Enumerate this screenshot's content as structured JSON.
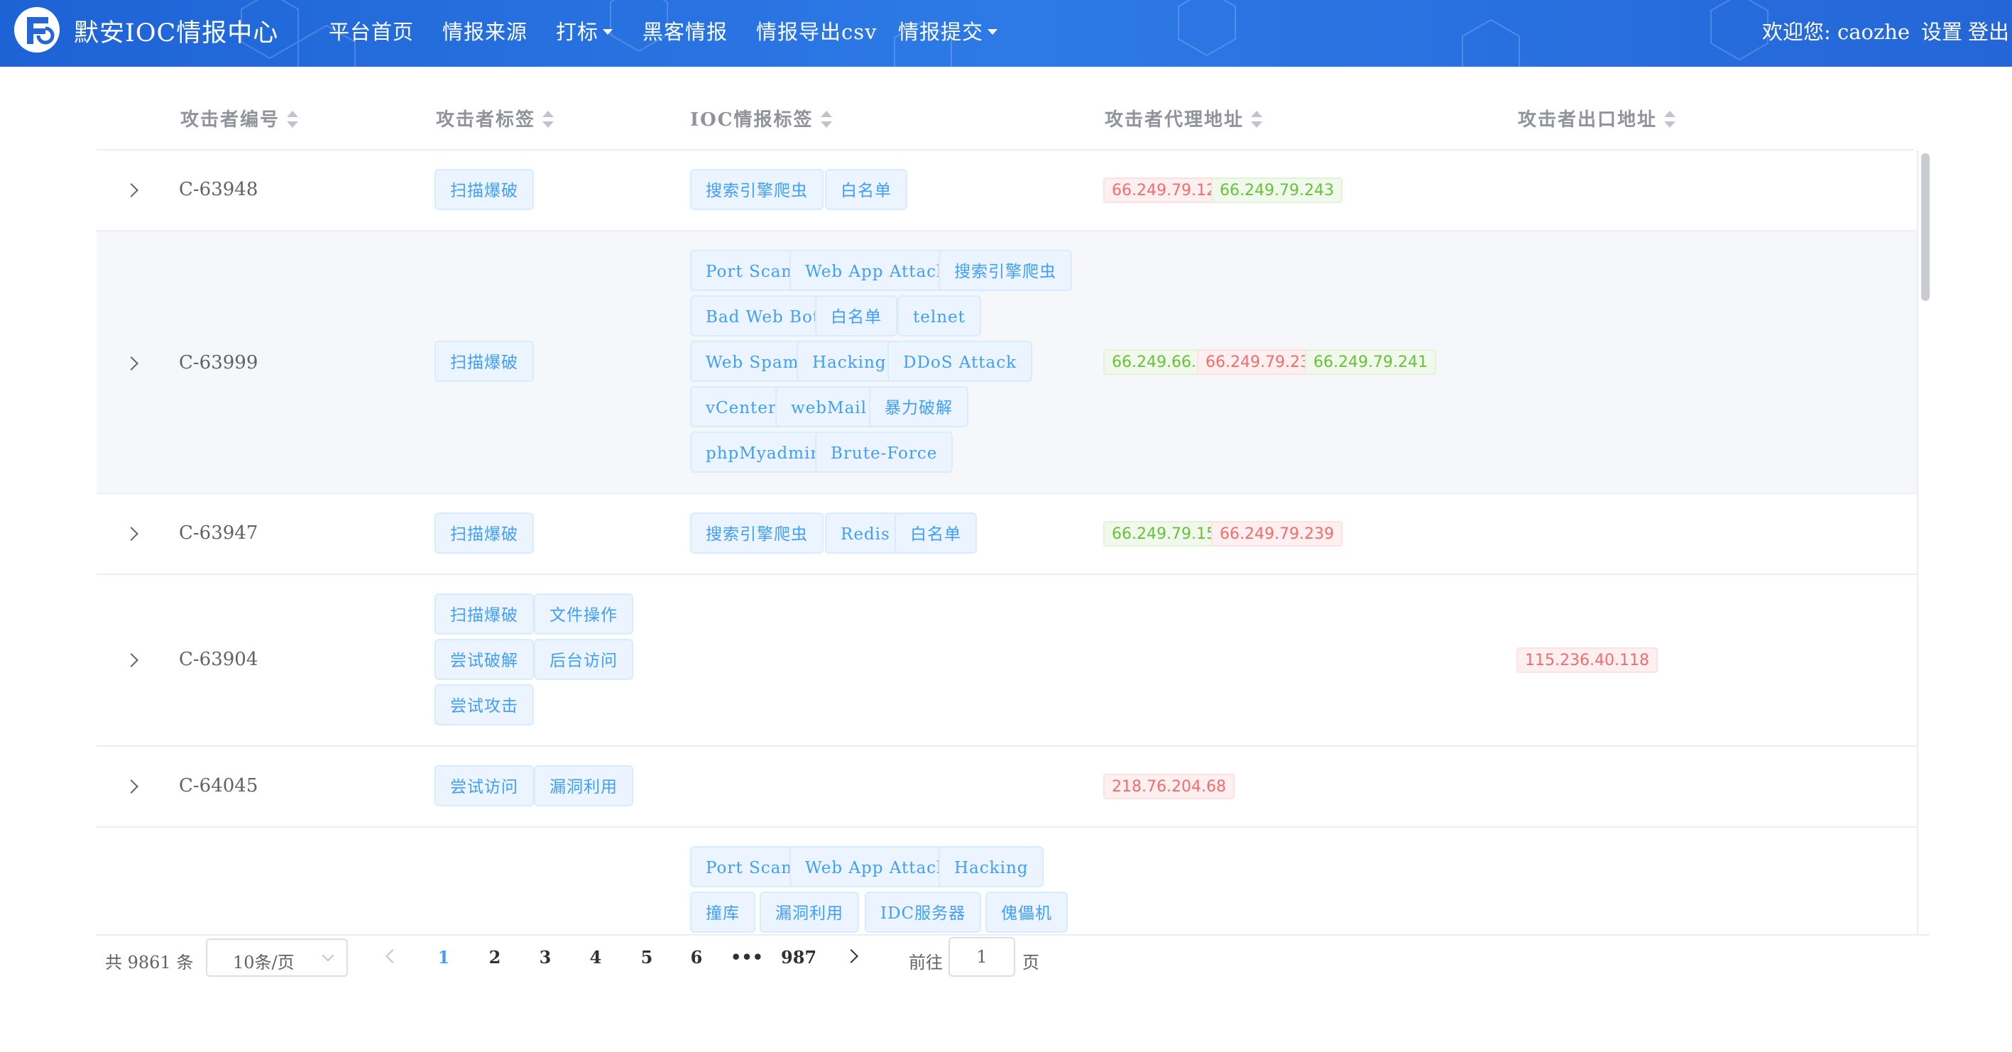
{
  "app": {
    "brand": "默安IOC情报中心"
  },
  "nav": {
    "items": [
      "平台首页",
      "情报来源",
      "打标",
      "黑客情报",
      "情报导出csv",
      "情报提交"
    ],
    "welcome": "欢迎您: caozhe",
    "settings": "设置",
    "logout": "登出"
  },
  "table": {
    "columns": [
      "攻击者编号",
      "攻击者标签",
      "IOC情报标签",
      "攻击者代理地址",
      "攻击者出口地址"
    ],
    "rows": [
      {
        "id": "C-63948",
        "attacker_tags": [
          "扫描爆破"
        ],
        "ioc_tags": [
          "搜索引擎爬虫",
          "白名单"
        ],
        "proxy_ips": [
          {
            "ip": "66.249.79.129",
            "color": "red"
          },
          {
            "ip": "66.249.79.243",
            "color": "green"
          }
        ],
        "exit_ips": []
      },
      {
        "id": "C-63999",
        "attacker_tags": [
          "扫描爆破"
        ],
        "ioc_tags": [
          "Port Scan",
          "Web App Attack",
          "搜索引擎爬虫",
          "Bad Web Bot",
          "白名单",
          "telnet",
          "Web Spam",
          "Hacking",
          "DDoS Attack",
          "vCenter",
          "webMail",
          "暴力破解",
          "phpMyadmin",
          "Brute-Force"
        ],
        "proxy_ips": [
          {
            "ip": "66.249.66.1",
            "color": "green"
          },
          {
            "ip": "66.249.79.239",
            "color": "red"
          },
          {
            "ip": "66.249.79.241",
            "color": "green"
          }
        ],
        "exit_ips": []
      },
      {
        "id": "C-63947",
        "attacker_tags": [
          "扫描爆破"
        ],
        "ioc_tags": [
          "搜索引擎爬虫",
          "Redis",
          "白名单"
        ],
        "proxy_ips": [
          {
            "ip": "66.249.79.159",
            "color": "green"
          },
          {
            "ip": "66.249.79.239",
            "color": "red"
          }
        ],
        "exit_ips": []
      },
      {
        "id": "C-63904",
        "attacker_tags": [
          "扫描爆破",
          "文件操作",
          "尝试破解",
          "后台访问",
          "尝试攻击"
        ],
        "ioc_tags": [],
        "proxy_ips": [],
        "exit_ips": [
          {
            "ip": "115.236.40.118",
            "color": "red"
          }
        ]
      },
      {
        "id": "C-64045",
        "attacker_tags": [
          "尝试访问",
          "漏洞利用"
        ],
        "ioc_tags": [],
        "proxy_ips": [
          {
            "ip": "218.76.204.68",
            "color": "red"
          }
        ],
        "exit_ips": []
      },
      {
        "id": "",
        "attacker_tags": [],
        "ioc_tags": [
          "Port Scan",
          "Web App Attack",
          "Hacking",
          "撞库",
          "漏洞利用",
          "IDC服务器",
          "傀儡机"
        ],
        "proxy_ips": [],
        "exit_ips": []
      }
    ]
  },
  "pagination": {
    "total": "共 9861 条",
    "page_size": "10条/页",
    "pages": [
      "1",
      "2",
      "3",
      "4",
      "5",
      "6",
      "•••",
      "987"
    ],
    "current": "1",
    "goto_label": "前往",
    "goto_value": "1",
    "goto_suffix": "页"
  },
  "colors": {
    "accent": "#409eff",
    "nav_bg": "#2466d8",
    "tag_red": "#f56c6c",
    "tag_green": "#67c23a"
  },
  "icons": {
    "logo": "brand-logo-icon",
    "sort": "sort-caret-icon",
    "expand": "chevron-right-icon"
  }
}
